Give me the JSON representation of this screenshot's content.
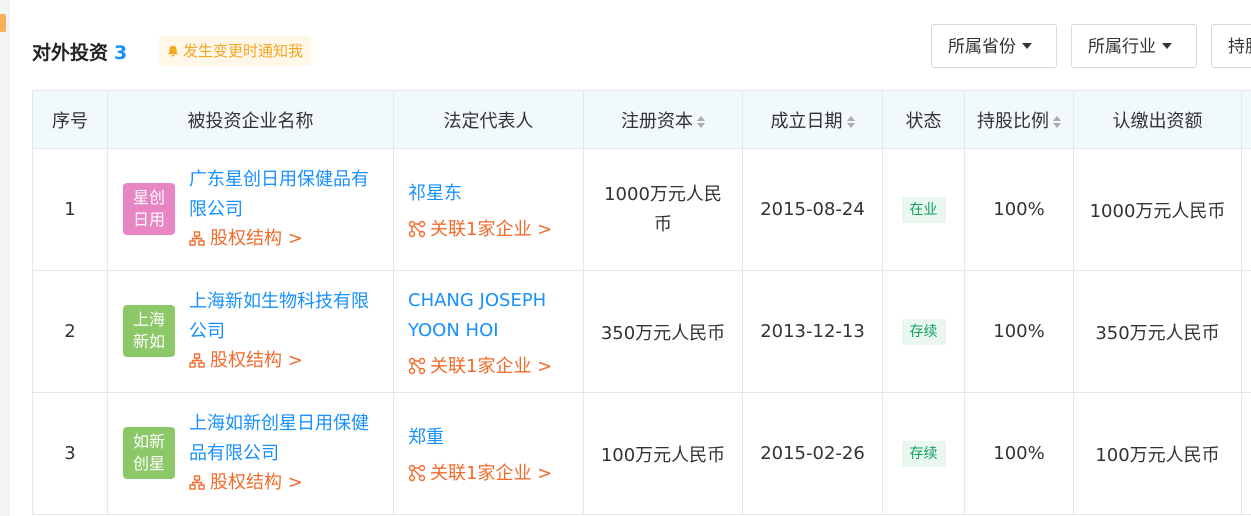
{
  "section": {
    "title": "对外投资",
    "count": "3",
    "notify_label": "发生变更时通知我"
  },
  "filters": [
    "所属省份",
    "所属行业",
    "持股"
  ],
  "table": {
    "headers": [
      "序号",
      "被投资企业名称",
      "法定代表人",
      "注册资本",
      "成立日期",
      "状态",
      "持股比例",
      "认缴出资额"
    ],
    "rows": [
      {
        "index": "1",
        "logo_text": "星创日用",
        "logo_color": "#e886c4",
        "company": "广东星创日用保健品有限公司",
        "equity_link": "股权结构 >",
        "rep_name": "祁星东",
        "rep_related": "关联1家企业 >",
        "capital": "1000万元人民币",
        "date": "2015-08-24",
        "status": "在业",
        "ratio": "100%",
        "subscribed": "1000万元人民币"
      },
      {
        "index": "2",
        "logo_text": "上海新如",
        "logo_color": "#8cc867",
        "company": "上海新如生物科技有限公司",
        "equity_link": "股权结构 >",
        "rep_name": "CHANG JOSEPH YOON HOI",
        "rep_related": "关联1家企业 >",
        "capital": "350万元人民币",
        "date": "2013-12-13",
        "status": "存续",
        "ratio": "100%",
        "subscribed": "350万元人民币"
      },
      {
        "index": "3",
        "logo_text": "如新创星",
        "logo_color": "#8cc867",
        "company": "上海如新创星日用保健品有限公司",
        "equity_link": "股权结构 >",
        "rep_name": "郑重",
        "rep_related": "关联1家企业 >",
        "capital": "100万元人民币",
        "date": "2015-02-26",
        "status": "存续",
        "ratio": "100%",
        "subscribed": "100万元人民币"
      }
    ]
  }
}
